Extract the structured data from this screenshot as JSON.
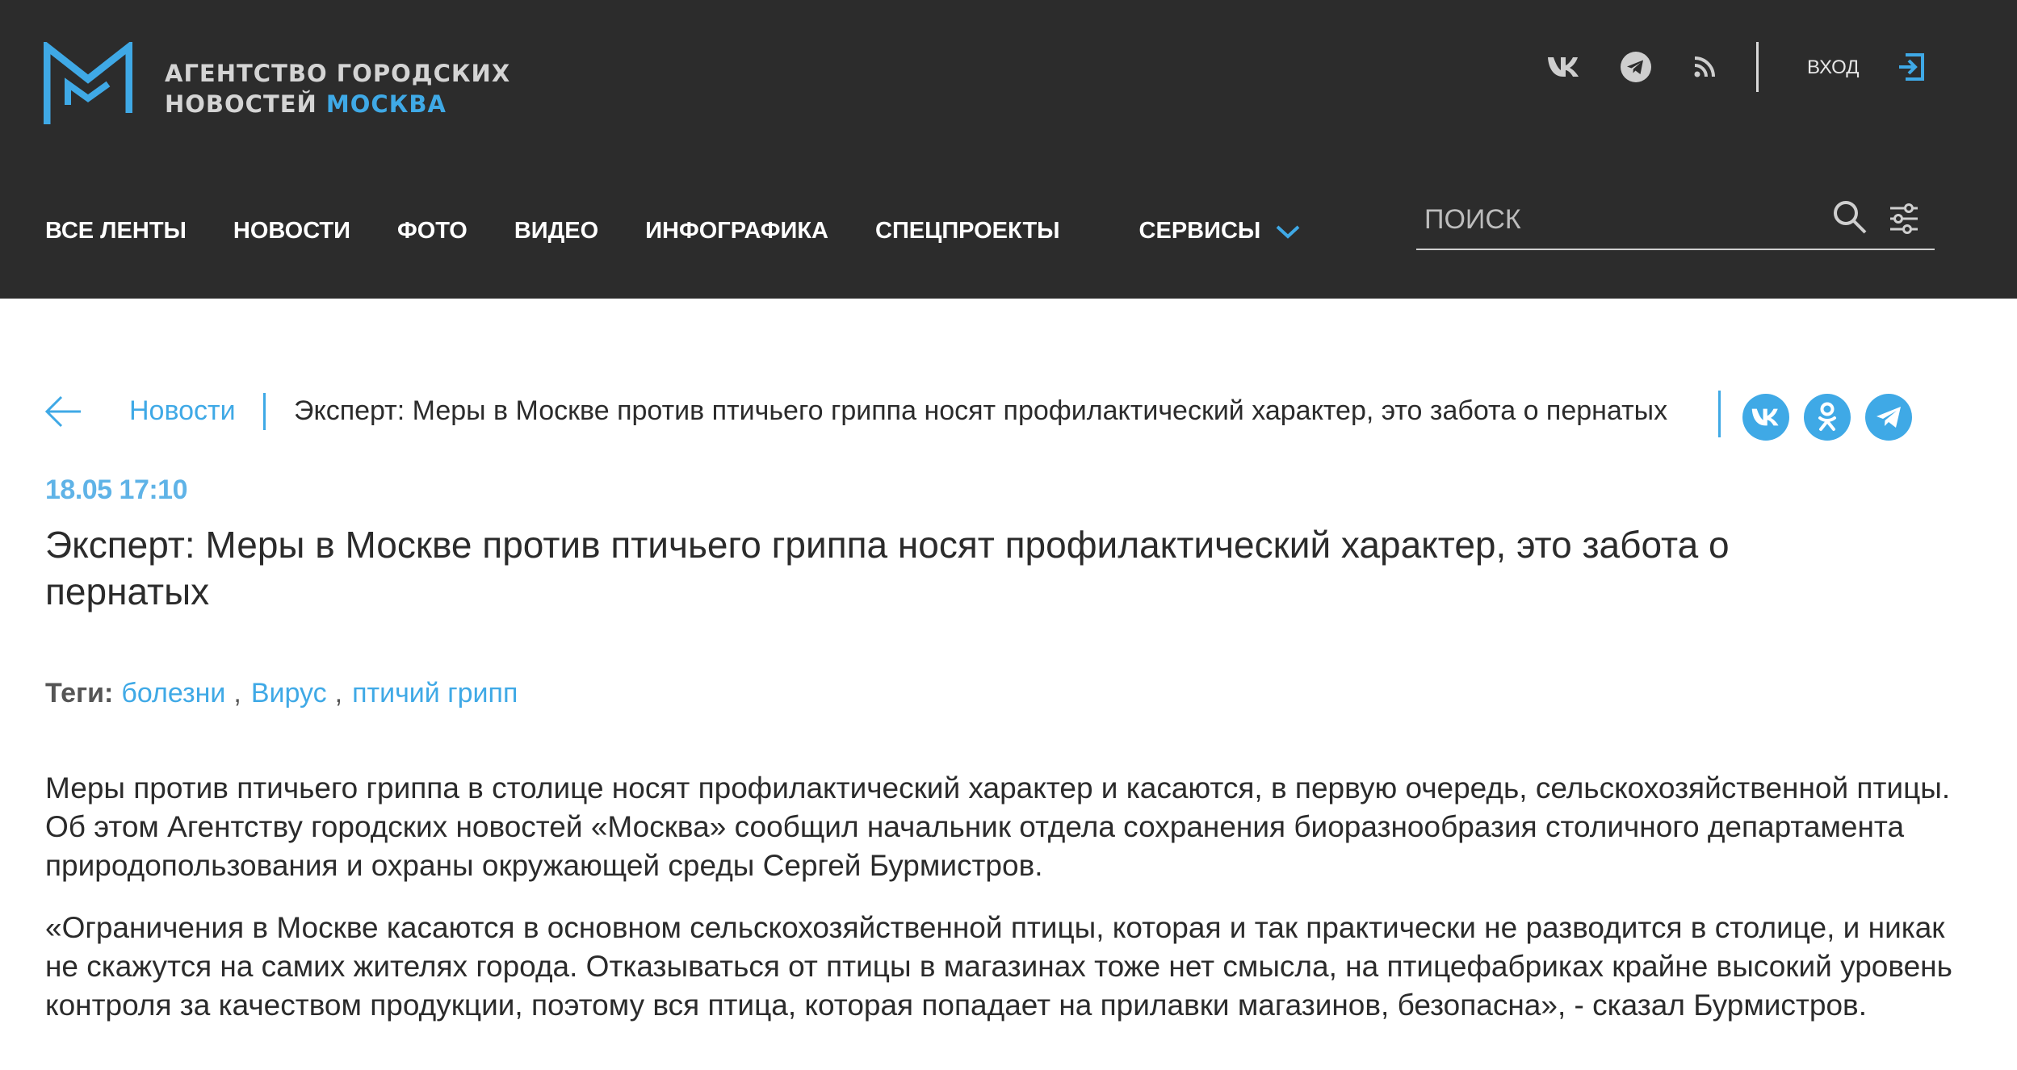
{
  "brand": {
    "line1": "Агентство городских",
    "line2_prefix": "новостей ",
    "line2_accent": "Москва",
    "accent_color": "#3fa9e6",
    "header_bg": "#2c2c2c"
  },
  "top_social": [
    {
      "icon": "vk-icon"
    },
    {
      "icon": "telegram-icon"
    },
    {
      "icon": "rss-icon"
    }
  ],
  "login": {
    "label": "Вход",
    "icon": "login-icon"
  },
  "nav": {
    "items": [
      "Все ленты",
      "Новости",
      "Фото",
      "Видео",
      "Инфографика",
      "Спецпроекты"
    ],
    "services": "Сервисы"
  },
  "search": {
    "placeholder": "Поиск"
  },
  "breadcrumb": {
    "section": "Новости",
    "current": "Эксперт: Меры в Москве против птичьего гриппа носят профилактический характер, это забота о пернатых"
  },
  "share": [
    {
      "icon": "vk-share-icon"
    },
    {
      "icon": "odnoklassniki-share-icon"
    },
    {
      "icon": "telegram-share-icon"
    }
  ],
  "article": {
    "date": "18.05 17:10",
    "title": "Эксперт: Меры в Москве против птичьего гриппа носят профилактический характер, это забота о пернатых",
    "tags_label": "Теги:",
    "tags": [
      "болезни",
      "Вирус",
      "птичий грипп"
    ],
    "paragraphs": [
      "Меры против птичьего гриппа в столице носят профилактический характер и касаются, в первую очередь, сельскохозяйственной птицы. Об этом Агентству городских новостей «Москва» сообщил начальник отдела сохранения биоразнообразия столичного департамента природопользования и охраны окружающей среды Сергей Бурмистров.",
      "«Ограничения в Москве касаются в основном сельскохозяйственной птицы, которая и так практически не разводится в столице, и никак не скажутся на самих жителях города. Отказываться от птицы в магазинах тоже нет смысла, на птицефабриках крайне высокий уровень контроля за качеством продукции, поэтому вся птица, которая попадает на прилавки магазинов, безопасна», - сказал Бурмистров."
    ]
  }
}
